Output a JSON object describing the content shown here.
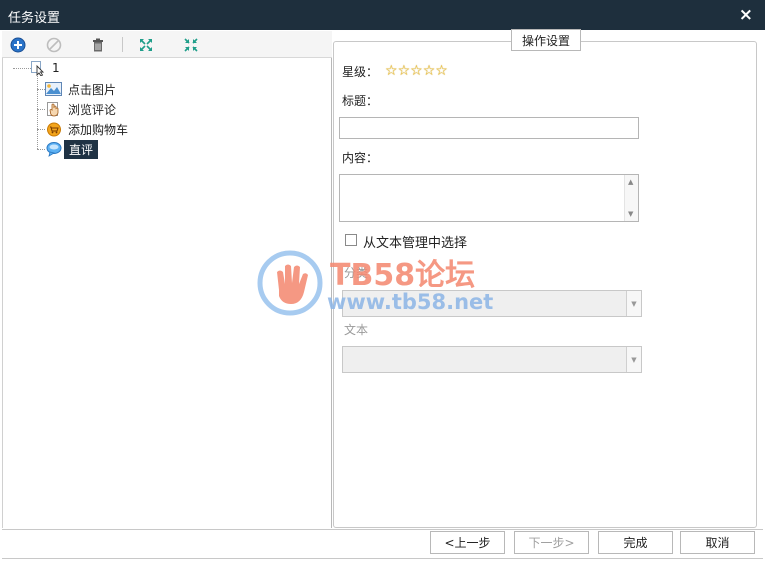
{
  "window": {
    "title": "任务设置",
    "close_glyph": "×"
  },
  "toolbar": {
    "buttons": [
      {
        "name": "add-icon",
        "color": "#2a73c8"
      },
      {
        "name": "disable-icon",
        "color": "#bdbdbd"
      },
      {
        "name": "trash-icon",
        "color": "#555555"
      },
      {
        "name": "expand-icon",
        "color": "#1f9e8a"
      },
      {
        "name": "collapse-icon",
        "color": "#1f9e8a"
      }
    ]
  },
  "tree": {
    "root": {
      "label": "1"
    },
    "items": [
      {
        "label": "点击图片",
        "icon": "image-icon"
      },
      {
        "label": "浏览评论",
        "icon": "hand-icon"
      },
      {
        "label": "添加购物车",
        "icon": "cart-icon"
      },
      {
        "label": "直评",
        "icon": "chat-bubble-icon",
        "selected": true
      }
    ]
  },
  "settings": {
    "group_title": "操作设置",
    "rating_label": "星级：",
    "stars": 5,
    "title_label": "标题：",
    "title_value": "",
    "content_label": "内容：",
    "content_value": "",
    "from_text_checkbox_label": "从文本管理中选择",
    "from_text_checked": false,
    "category_label": "分类",
    "category_value": "",
    "text_label": "文本",
    "text_value": ""
  },
  "footer": {
    "prev": "<上一步",
    "next": "下一步>",
    "finish": "完成",
    "cancel": "取消"
  },
  "watermark": {
    "line1": "TB58论坛",
    "line2": "www.tb58.net"
  },
  "colors": {
    "titlebar": "#1e2f3d",
    "selected": "#1f3244",
    "star": "#f2c33b"
  }
}
